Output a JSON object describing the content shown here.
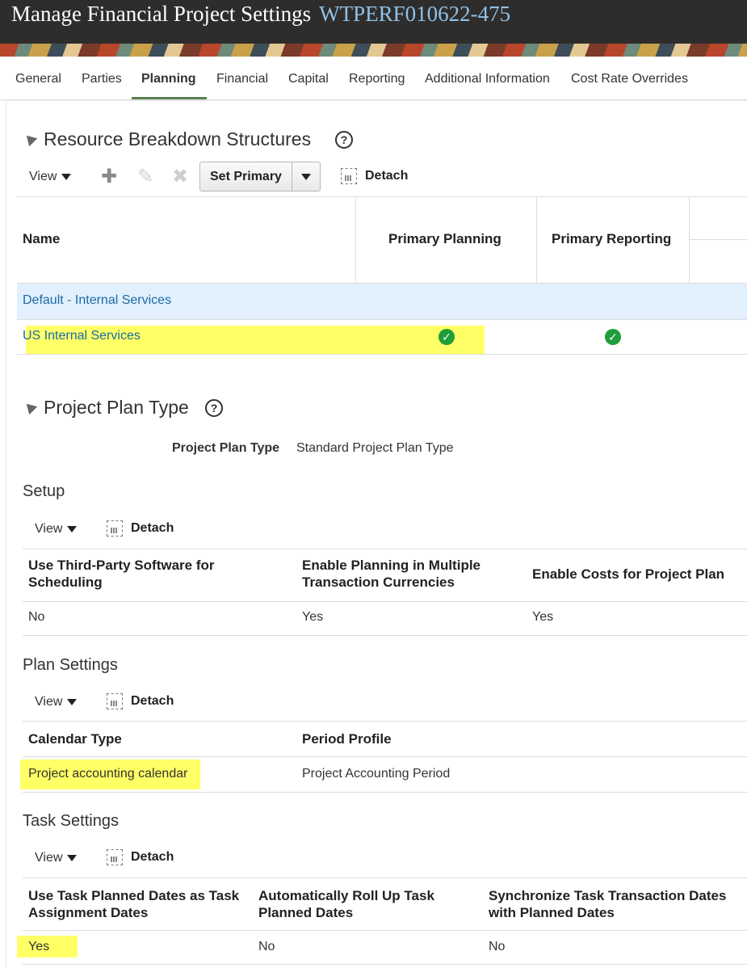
{
  "header": {
    "title": "Manage Financial Project Settings",
    "project_number": "WTPERF010622-475"
  },
  "tabs": [
    {
      "label": "General"
    },
    {
      "label": "Parties"
    },
    {
      "label": "Planning",
      "active": true
    },
    {
      "label": "Financial"
    },
    {
      "label": "Capital"
    },
    {
      "label": "Reporting"
    },
    {
      "label": "Additional Information"
    },
    {
      "label": "Cost Rate Overrides"
    }
  ],
  "rbs": {
    "title": "Resource Breakdown Structures",
    "help": "?",
    "toolbar": {
      "view_label": "View",
      "add_icon": "plus-icon",
      "edit_icon": "pencil-icon",
      "delete_icon": "x-icon",
      "set_primary_label": "Set Primary",
      "detach_label": "Detach"
    },
    "columns": [
      "Name",
      "Primary Planning",
      "Primary Reporting"
    ],
    "rows": [
      {
        "name": "Default - Internal Services",
        "primary_planning": false,
        "primary_reporting": false,
        "selected": true
      },
      {
        "name": "US Internal Services",
        "primary_planning": true,
        "primary_reporting": true,
        "selected": false
      }
    ]
  },
  "plan_type": {
    "title": "Project Plan Type",
    "help": "?",
    "field_label": "Project Plan Type",
    "field_value": "Standard Project Plan Type"
  },
  "setup": {
    "title": "Setup",
    "view_label": "View",
    "detach_label": "Detach",
    "columns": [
      "Use Third-Party Software for Scheduling",
      "Enable Planning in Multiple Transaction Currencies",
      "Enable Costs for Project Plan"
    ],
    "row": [
      "No",
      "Yes",
      "Yes"
    ]
  },
  "plan_settings": {
    "title": "Plan Settings",
    "view_label": "View",
    "detach_label": "Detach",
    "columns": [
      "Calendar Type",
      "Period Profile"
    ],
    "row": [
      "Project accounting calendar",
      "Project Accounting Period"
    ]
  },
  "task_settings": {
    "title": "Task Settings",
    "view_label": "View",
    "detach_label": "Detach",
    "columns": [
      "Use Task Planned Dates as Task Assignment Dates",
      "Automatically Roll Up Task Planned Dates",
      "Synchronize Task Transaction Dates with Planned Dates"
    ],
    "row": [
      "Yes",
      "No",
      "No"
    ]
  },
  "colors": {
    "header_bg": "#2f2d2b",
    "project_number": "#8fc1ea",
    "tab_underline": "#5a7f52",
    "link": "#1a6aa6",
    "highlight": "#ffff66",
    "check": "#1f9e3a",
    "selected_row": "#e2f0fd"
  }
}
